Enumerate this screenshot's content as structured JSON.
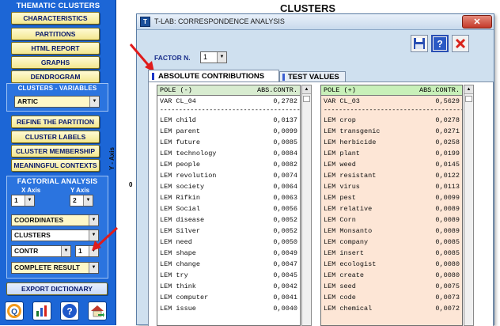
{
  "sidebar": {
    "thematic_title": "THEMATIC CLUSTERS",
    "buttons_top": [
      "CHARACTERISTICS",
      "PARTITIONS",
      "HTML REPORT",
      "GRAPHS",
      "DENDROGRAM"
    ],
    "variables_title": "CLUSTERS - VARIABLES",
    "variable_value": "ARTIC",
    "buttons_mid": [
      "REFINE THE PARTITION",
      "CLUSTER LABELS",
      "CLUSTER MEMBERSHIP",
      "MEANINGFUL CONTEXTS"
    ],
    "factorial_title": "FACTORIAL ANALYSIS",
    "x_axis_label": "X Axis",
    "y_axis_label": "Y Axis",
    "x_axis_value": "1",
    "y_axis_value": "2",
    "coordinates_value": "COORDINATES",
    "clusters_value": "CLUSTERS",
    "contr_value": "CONTR",
    "contr_num_value": "1",
    "complete_value": "COMPLETE RESULT",
    "export_button": "EXPORT DICTIONARY",
    "bottom_icons": [
      "q-logo-icon",
      "chart-icon",
      "help-icon",
      "home-icon"
    ]
  },
  "main": {
    "title": "CLUSTERS",
    "y_axis": "Y - Axis",
    "zero": "0"
  },
  "dialog": {
    "title": "T-LAB: CORRESPONDENCE ANALYSIS",
    "title_icon": "T",
    "factor_label": "FACTOR N.",
    "factor_value": "1",
    "tabs": [
      "ABSOLUTE CONTRIBUTIONS",
      "TEST VALUES"
    ],
    "neg": {
      "header_left": "POLE (-)",
      "header_right": "ABS.CONTR.",
      "var_left": "VAR CL_04",
      "var_right": "0,2782",
      "separator": "----------------------------------------",
      "rows": [
        [
          "LEM child",
          "0,0137"
        ],
        [
          "LEM parent",
          "0,0099"
        ],
        [
          "LEM future",
          "0,0085"
        ],
        [
          "LEM technology",
          "0,0084"
        ],
        [
          "LEM people",
          "0,0082"
        ],
        [
          "LEM revolution",
          "0,0074"
        ],
        [
          "LEM society",
          "0,0064"
        ],
        [
          "LEM Rifkin",
          "0,0063"
        ],
        [
          "LEM Social",
          "0,0056"
        ],
        [
          "LEM disease",
          "0,0052"
        ],
        [
          "LEM Silver",
          "0,0052"
        ],
        [
          "LEM need",
          "0,0050"
        ],
        [
          "LEM shape",
          "0,0049"
        ],
        [
          "LEM change",
          "0,0047"
        ],
        [
          "LEM try",
          "0,0045"
        ],
        [
          "LEM think",
          "0,0042"
        ],
        [
          "LEM computer",
          "0,0041"
        ],
        [
          "LEM issue",
          "0,0040"
        ]
      ]
    },
    "pos": {
      "header_left": "POLE (+)",
      "header_right": "ABS.CONTR.",
      "var_left": "VAR CL_03",
      "var_right": "0,5629",
      "separator": "----------------------------------------",
      "rows": [
        [
          "LEM crop",
          "0,0278"
        ],
        [
          "LEM transgenic",
          "0,0271"
        ],
        [
          "LEM herbicide",
          "0,0258"
        ],
        [
          "LEM plant",
          "0,0199"
        ],
        [
          "LEM weed",
          "0,0145"
        ],
        [
          "LEM resistant",
          "0,0122"
        ],
        [
          "LEM virus",
          "0,0113"
        ],
        [
          "LEM pest",
          "0,0099"
        ],
        [
          "LEM relative",
          "0,0089"
        ],
        [
          "LEM Corn",
          "0,0089"
        ],
        [
          "LEM Monsanto",
          "0,0089"
        ],
        [
          "LEM company",
          "0,0085"
        ],
        [
          "LEM insert",
          "0,0085"
        ],
        [
          "LEM ecologist",
          "0,0080"
        ],
        [
          "LEM create",
          "0,0080"
        ],
        [
          "LEM seed",
          "0,0075"
        ],
        [
          "LEM code",
          "0,0073"
        ],
        [
          "LEM chemical",
          "0,0072"
        ]
      ]
    }
  },
  "colors": {
    "sidebar_bg": "#1c66d6",
    "button_bg": "#f8efa8",
    "dialog_bg": "#cfe0ef",
    "neg_table_bg": "#ffffff",
    "pos_table_bg": "#fde6d6",
    "arrow": "#e01b1b"
  }
}
